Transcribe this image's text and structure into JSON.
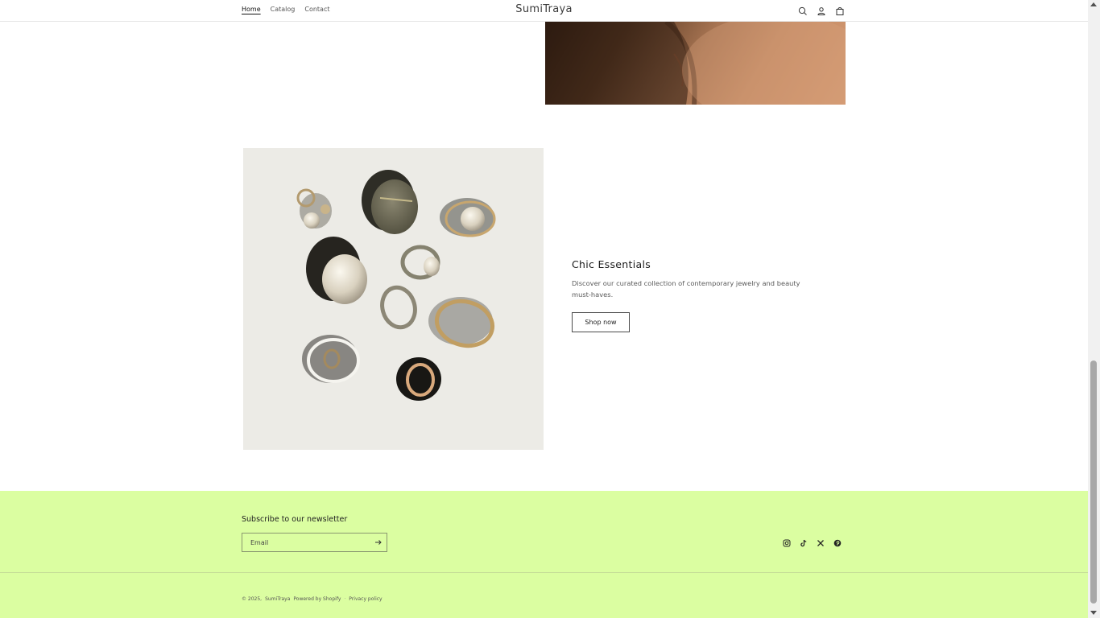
{
  "header": {
    "nav": [
      {
        "label": "Home",
        "active": true
      },
      {
        "label": "Catalog",
        "active": false
      },
      {
        "label": "Contact",
        "active": false
      }
    ],
    "logo": "SumiTraya",
    "icons": [
      "search-icon",
      "account-icon",
      "cart-icon"
    ]
  },
  "feature": {
    "title": "Chic Essentials",
    "description": "Discover our curated collection of contemporary jewelry and beauty must-haves.",
    "button_label": "Shop now"
  },
  "footer": {
    "background_color": "#dbfea1",
    "newsletter_title": "Subscribe to our newsletter",
    "email_placeholder": "Email",
    "social_icons": [
      "instagram-icon",
      "tiktok-icon",
      "x-icon",
      "pinterest-icon"
    ],
    "copyright": "© 2025,",
    "store_link": "SumiTraya",
    "powered_by": "Powered by Shopify",
    "separator": "·",
    "privacy_link": "Privacy policy"
  }
}
